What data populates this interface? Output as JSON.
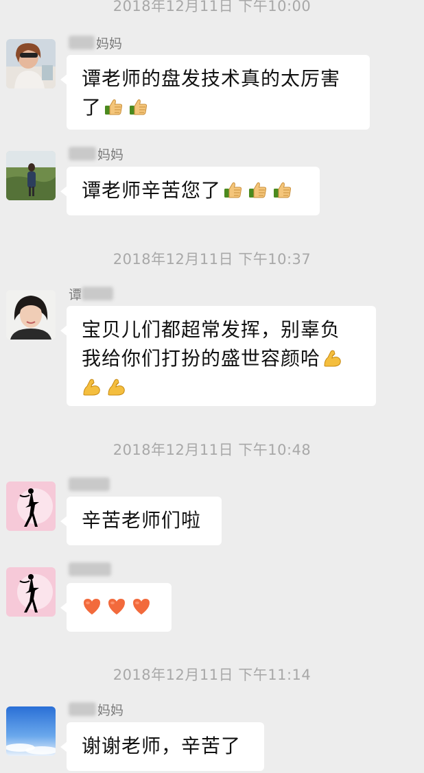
{
  "timestamps": [
    "2018年12月11日 下午10:00",
    "2018年12月11日 下午10:37",
    "2018年12月11日 下午10:48",
    "2018年12月11日 下午11:14"
  ],
  "messages": [
    {
      "sender_suffix": "妈妈",
      "line1": "谭老师的盘发技术真的太厉害",
      "line2": "了",
      "emojis": [
        "thumbs-up",
        "thumbs-up"
      ]
    },
    {
      "sender_suffix": "妈妈",
      "line1": "谭老师辛苦您了",
      "emojis": [
        "thumbs-up",
        "thumbs-up",
        "thumbs-up"
      ]
    },
    {
      "sender_prefix": "谭",
      "line1": "宝贝儿们都超常发挥，别辜负",
      "line2": "我给你们打扮的盛世容颜哈",
      "emojis": [
        "flexed-biceps",
        "flexed-biceps",
        "flexed-biceps"
      ]
    },
    {
      "sender_suffix": "",
      "line1": "辛苦老师们啦"
    },
    {
      "sender_suffix": "",
      "emojis": [
        "heart",
        "heart",
        "heart"
      ]
    },
    {
      "sender_suffix": "妈妈",
      "line1": "谢谢老师，辛苦了"
    }
  ]
}
